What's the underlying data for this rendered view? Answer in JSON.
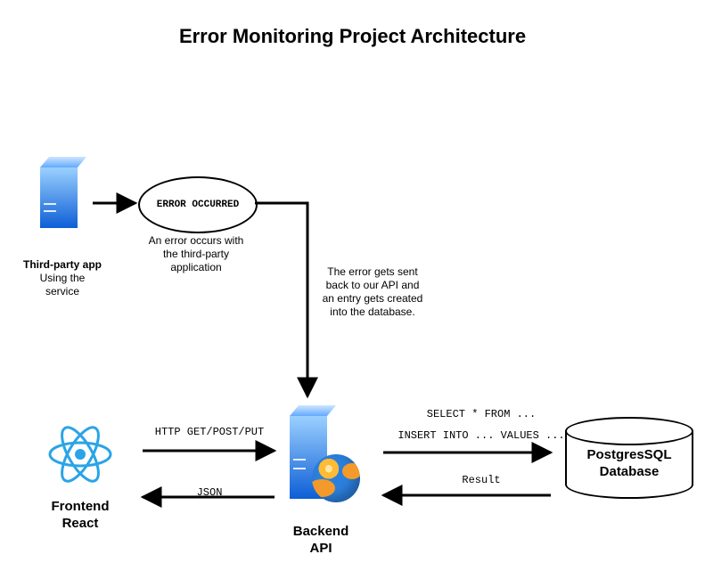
{
  "title": "Error Monitoring Project Architecture",
  "nodes": {
    "third_party": {
      "title": "Third-party app",
      "subtitle": "Using the\nservice"
    },
    "error_event": {
      "label": "ERROR OCCURRED",
      "caption": "An error occurs with\nthe third-party\napplication"
    },
    "error_flow_caption": "The error gets sent\nback to our API and\nan entry gets created\ninto the database.",
    "frontend": {
      "title": "Frontend\nReact"
    },
    "backend": {
      "title": "Backend\nAPI"
    },
    "database": {
      "title": "PostgresSQL\nDatabase"
    }
  },
  "edges": {
    "fe_to_be": "HTTP GET/POST/PUT",
    "be_to_fe": "JSON",
    "be_to_db_line1": "SELECT * FROM ...",
    "be_to_db_line2": "INSERT INTO ... VALUES ...",
    "db_to_be": "Result"
  },
  "colors": {
    "server_gradient_top": "#9bd0ff",
    "server_gradient_bottom": "#0d5ed6",
    "react_blue": "#2aa4e6",
    "globe_blue": "#2b7fdc",
    "globe_orange": "#f39a2b"
  }
}
